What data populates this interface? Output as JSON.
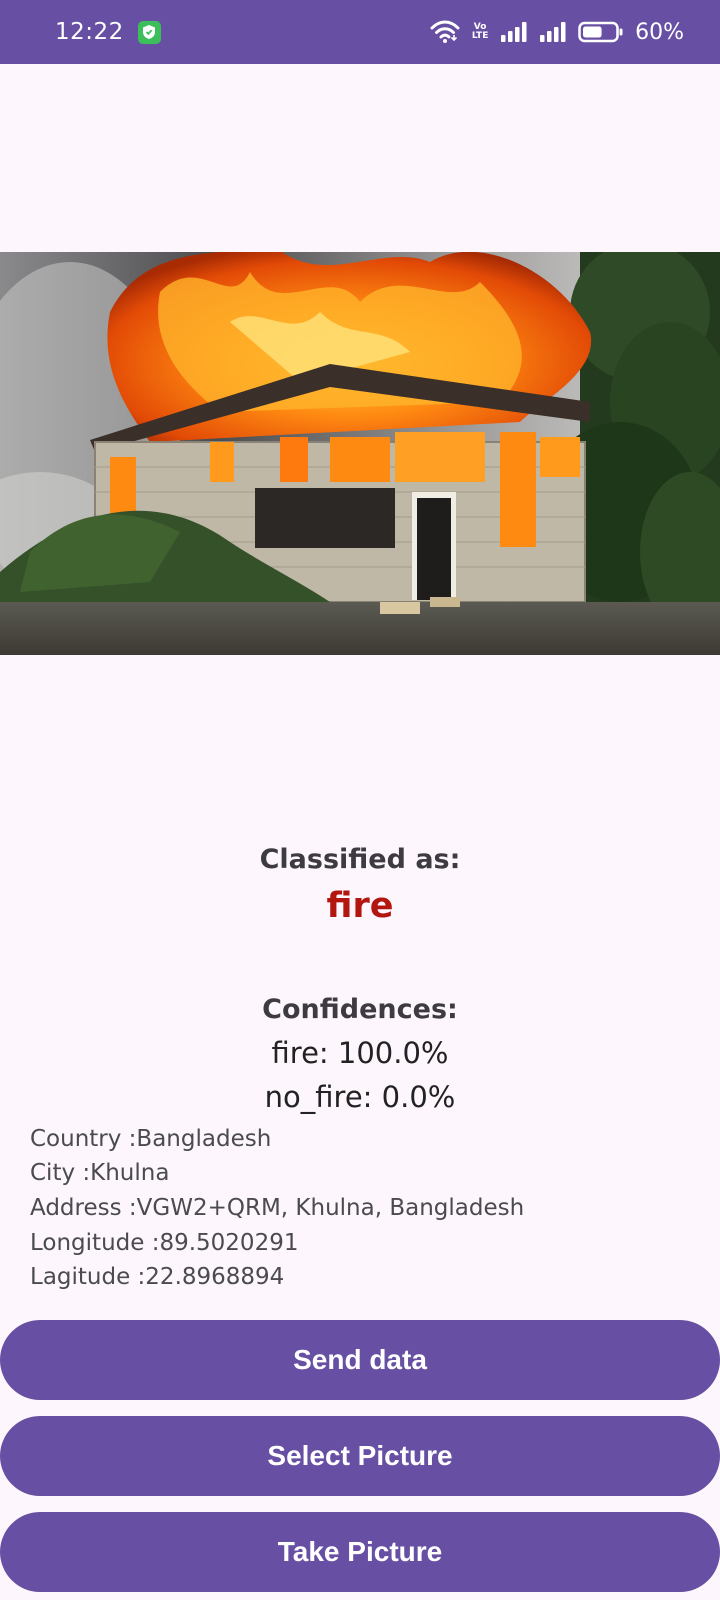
{
  "status_bar": {
    "time": "12:22",
    "network_label": "Vo\nLTE",
    "battery_percent": "60%",
    "battery_level": 0.6,
    "icons": [
      "shield-check-icon",
      "wifi-icon",
      "volte-icon",
      "signal-icon",
      "signal-icon",
      "battery-icon"
    ]
  },
  "image": {
    "icon": "house-fire-photo"
  },
  "classification": {
    "label": "Classified as:",
    "value": "fire"
  },
  "confidences": {
    "label": "Confidences:",
    "rows": [
      "fire: 100.0%",
      "no_fire: 0.0%"
    ]
  },
  "location": {
    "country": "Country :Bangladesh",
    "city": "City :Khulna",
    "address": "Address :VGW2+QRM, Khulna, Bangladesh",
    "longitude": "Longitude :89.5020291",
    "latitude": "Lagitude :22.8968894"
  },
  "buttons": {
    "send": "Send data",
    "select": "Select Picture",
    "take": "Take Picture"
  },
  "colors": {
    "primary": "#6750a4",
    "result": "#b3150f",
    "background": "#fdf7fd"
  }
}
